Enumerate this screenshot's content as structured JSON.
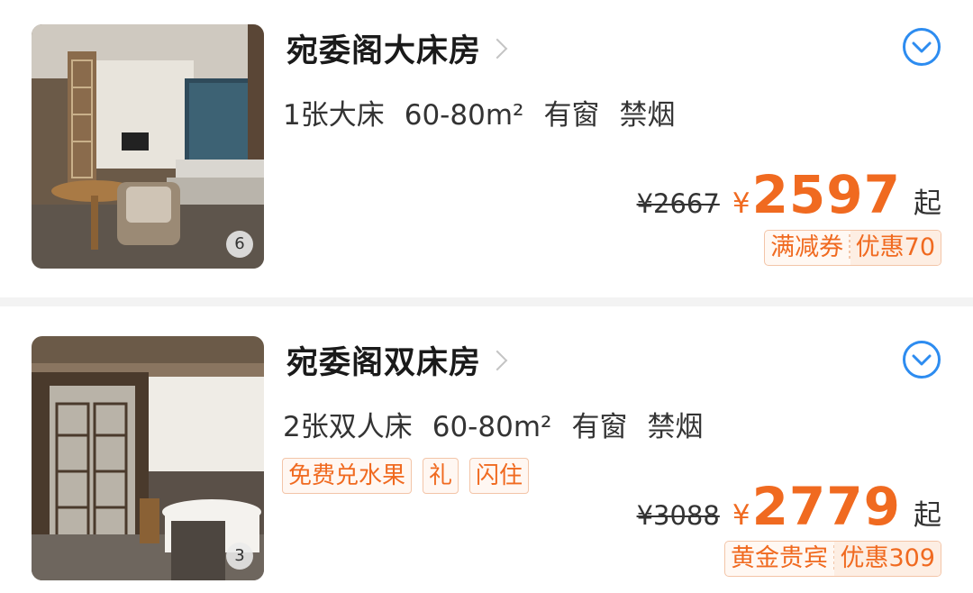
{
  "rooms": [
    {
      "name": "宛委阁大床房",
      "photo_count": "6",
      "specs": [
        "1张大床",
        "60-80m²",
        "有窗",
        "禁烟"
      ],
      "tags": [],
      "original_price": "¥2667",
      "currency": "¥",
      "price": "2597",
      "price_suffix": "起",
      "promo_type": "满减券",
      "promo_value": "优惠70"
    },
    {
      "name": "宛委阁双床房",
      "photo_count": "3",
      "specs": [
        "2张双人床",
        "60-80m²",
        "有窗",
        "禁烟"
      ],
      "tags": [
        "免费兑水果",
        "礼",
        "闪住"
      ],
      "original_price": "¥3088",
      "currency": "¥",
      "price": "2779",
      "price_suffix": "起",
      "promo_type": "黄金贵宾",
      "promo_value": "优惠309"
    }
  ],
  "icons": {
    "expand": "chevron-down-circle-icon",
    "detail": "chevron-right-icon"
  },
  "colors": {
    "accent": "#f06a20",
    "tag_border": "#f3c5a8",
    "icon_blue": "#2d8cf0"
  }
}
